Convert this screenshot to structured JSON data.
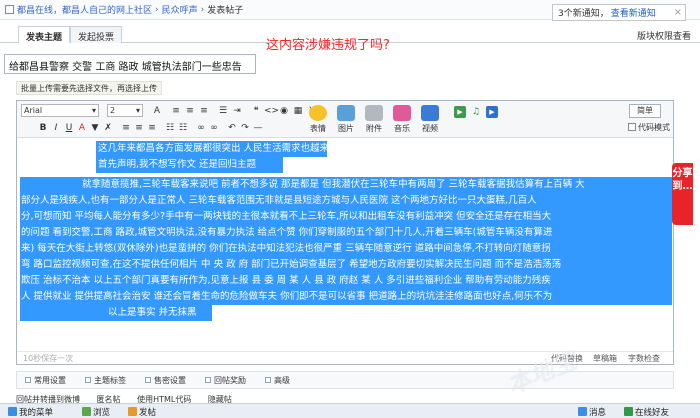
{
  "breadcrumb": {
    "site": "都昌在线，都昌人自己的网上社区",
    "forum": "民众呼声",
    "page": "发表帖子"
  },
  "notice": {
    "count_text": "3个新通知，",
    "link": "查看新通知"
  },
  "tabs": {
    "post": "发表主题",
    "poll": "发起投票",
    "mode": "版块权限查看"
  },
  "annotation": "这内容涉嫌违规了吗?",
  "title_value": "给都昌县警察 交警 工商 路政 城管执法部门一些忠告",
  "upload_hint": "批量上传需要先选择文件，再选择上传",
  "toolbar": {
    "font": "Arial",
    "size": "2",
    "big": [
      {
        "name": "emoticon",
        "label": "表情"
      },
      {
        "name": "image",
        "label": "图片"
      },
      {
        "name": "attachment",
        "label": "附件"
      },
      {
        "name": "music",
        "label": "音乐"
      },
      {
        "name": "video",
        "label": "视频"
      }
    ],
    "simple": "简单",
    "code_mode": "代码模式",
    "row1": [
      {
        "n": "forecolor-icon",
        "g": "A"
      },
      {
        "n": "align-left-icon",
        "g": "≡"
      },
      {
        "n": "align-center-icon",
        "g": "≡"
      },
      {
        "n": "align-right-icon",
        "g": "≡"
      },
      {
        "n": "list-icon",
        "g": "☰"
      },
      {
        "n": "indent-icon",
        "g": "⇥"
      },
      {
        "n": "quote-icon",
        "g": "❝"
      },
      {
        "n": "code-icon",
        "g": "<>"
      },
      {
        "n": "hide-icon",
        "g": "◉"
      },
      {
        "n": "table-icon",
        "g": "▦"
      },
      {
        "n": "free-icon",
        "g": "¥"
      }
    ],
    "row2": [
      {
        "n": "bold-icon",
        "g": "B"
      },
      {
        "n": "italic-icon",
        "g": "I"
      },
      {
        "n": "underline-icon",
        "g": "U"
      },
      {
        "n": "font-color-icon",
        "g": "A"
      },
      {
        "n": "bgcolor-icon",
        "g": "▼"
      },
      {
        "n": "removeformat-icon",
        "g": "✗"
      },
      {
        "n": "left-icon",
        "g": "≡"
      },
      {
        "n": "center-icon",
        "g": "≡"
      },
      {
        "n": "right-icon",
        "g": "≡"
      },
      {
        "n": "ol-icon",
        "g": "☷"
      },
      {
        "n": "ul-icon",
        "g": "☷"
      },
      {
        "n": "link-icon",
        "g": "∞"
      },
      {
        "n": "unlink-icon",
        "g": "∞"
      },
      {
        "n": "undo-icon",
        "g": "↶"
      },
      {
        "n": "redo-icon",
        "g": "↷"
      },
      {
        "n": "hr-icon",
        "g": "—"
      }
    ]
  },
  "content_lines": [
    "这几年来都昌各方面发展都很突出 人民生活需求也越来越多了",
    "首先声明,我不想写作文 还是回归主题",
    "就拿随意揽推,三轮车载客来说吧 前者不想多说 那是都是 但我潜伏在三轮车中有两周了 三轮车载客据我估算有上百辆 大",
    "部分人是残疾人,也有一部分人是正常人 三轮车载客范围无非就是县短途方城与人民医院 这个两地方好比一只大蛋糕,几百人",
    "分,可想而知 平均每人能分有多少?手中有一两块钱的主很本就看不上三轮车,所以和出租车没有利益冲突 但安全还是存在相当大",
    "的问题 看到交警,工商 路政,城管文明执法,没有暴力执法 给点个赞 你们穿制服的五个部门十几人,开着三辆车(城管车辆没有算进",
    "来) 每天在大街上转悠(双休除外)也是蛮拼的 你们在执法中知法犯法也很严重 三辆车随意逆行 道路中间急停,不打转向灯随意拐",
    "弯 路口监控视频可查,在这不提供任何相片 中 央 政 府 部门已开始调查基层了 希望地方政府要切实解决民生问题 而不是浩浩荡荡",
    "欺压 治标不治本 以上五个部门真要有所作为,见意上报 县 委 周 某 人 县 政 府赵 某 人 多引进些福利企业 帮助有劳动能力残疾",
    "人 提供就业 提供提高社会治安 谁还会冒着生命的危险做车夫 你们即不是可以省事 把道路上的坑坑洼洼修路面也好点,何乐不为",
    "以上是事实 并无抹黑"
  ],
  "status": {
    "autosave": "10秒保存一次",
    "replace": "代码替换",
    "draft": "草稿箱",
    "wordcount": "字数检查"
  },
  "settings_tabs": [
    "常用设置",
    "主题标签",
    "售密设置",
    "回帖奖励",
    "高级"
  ],
  "options": [
    "回帖并转播到微博",
    "匿名帖",
    "使用HTML代码",
    "隐藏帖"
  ],
  "bottom_bar": {
    "menu": "我的菜单",
    "browse": "浏览",
    "post": "发帖",
    "msg": "消息",
    "online": "在线好友"
  },
  "share_label": "分享到…",
  "watermark": "本地宝"
}
